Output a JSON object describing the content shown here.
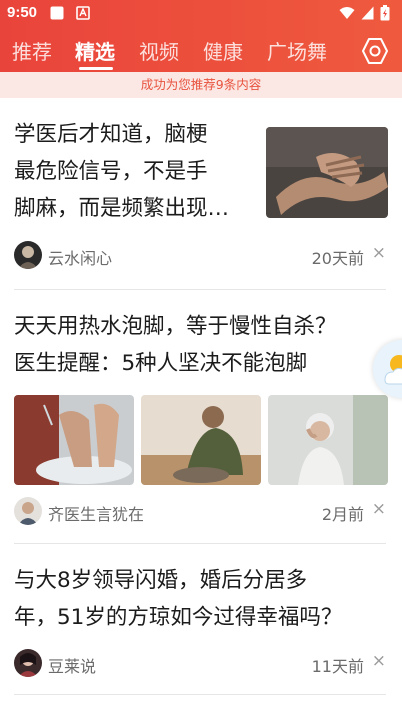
{
  "status_bar": {
    "time": "9:50",
    "icons": [
      "image-icon",
      "app-a-icon",
      "wifi-icon",
      "signal-icon",
      "battery-charging-icon"
    ]
  },
  "tabs": [
    {
      "label": "推荐",
      "active": false
    },
    {
      "label": "精选",
      "active": true
    },
    {
      "label": "视频",
      "active": false
    },
    {
      "label": "健康",
      "active": false
    },
    {
      "label": "广场舞",
      "active": false
    }
  ],
  "settings_icon": "settings-hexagon-icon",
  "notice": "成功为您推荐9条内容",
  "articles": [
    {
      "title_lines": [
        "学医后才知道，脑梗",
        "最危险信号，不是手",
        "脚麻，而是频繁出现…"
      ],
      "author": "云水闲心",
      "time": "20天前",
      "close": "×"
    },
    {
      "title_lines": [
        "天天用热水泡脚，等于慢性自杀？",
        "医生提醒：5种人坚决不能泡脚"
      ],
      "author": "齐医生言犹在",
      "time": "2月前",
      "close": "×"
    },
    {
      "title_lines": [
        "与大8岁领导闪婚，婚后分居多",
        "年，51岁的方琼如今过得幸福吗？"
      ],
      "author": "豆莱说",
      "time": "11天前",
      "close": "×"
    }
  ],
  "colors": {
    "header": "#e9443b",
    "notice_bg": "#fbe7e3",
    "notice_text": "#e8533f"
  }
}
